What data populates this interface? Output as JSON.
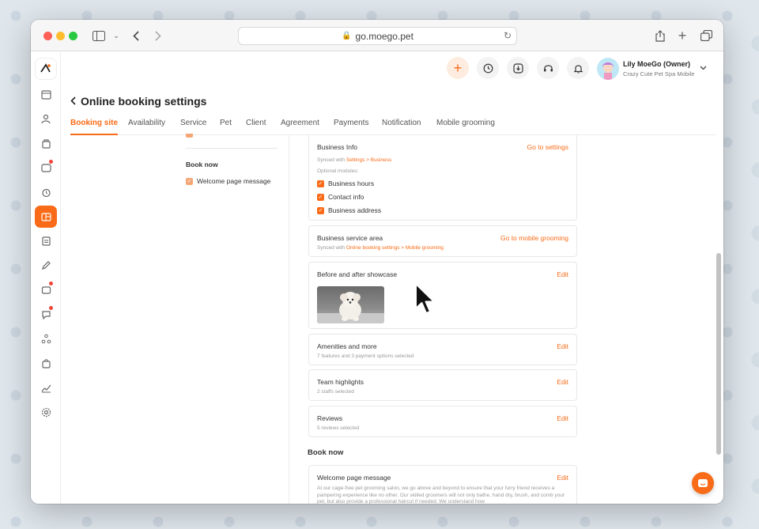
{
  "browser": {
    "url": "go.moego.pet"
  },
  "header": {
    "user_name": "Lily MoeGo (Owner)",
    "business_name": "Crazy Cute Pet Spa Mobile"
  },
  "page": {
    "title": "Online booking settings",
    "tabs": [
      {
        "label": "Booking site",
        "active": true
      },
      {
        "label": "Availability",
        "active": false
      },
      {
        "label": "Service",
        "active": false
      },
      {
        "label": "Pet",
        "active": false
      },
      {
        "label": "Client",
        "active": false
      },
      {
        "label": "Agreement",
        "active": false
      },
      {
        "label": "Payments",
        "active": false
      },
      {
        "label": "Notification",
        "active": false
      },
      {
        "label": "Mobile grooming",
        "active": false
      }
    ]
  },
  "sidebar": {
    "book_now_heading": "Book now",
    "welcome_check_label": "Welcome page message"
  },
  "cards": {
    "business_info": {
      "title": "Business Info",
      "link": "Go to settings",
      "synced_prefix": "Synced with ",
      "synced_path": "Settings > Business",
      "optional_label": "Optional modules:",
      "options": [
        "Business hours",
        "Contact info",
        "Business address"
      ]
    },
    "service_area": {
      "title": "Business service area",
      "link": "Go to mobile grooming",
      "synced_prefix": "Synced with ",
      "synced_path": "Online booking settings > Mobile grooming"
    },
    "showcase": {
      "title": "Before and after showcase",
      "link": "Edit"
    },
    "amenities": {
      "title": "Amenities and more",
      "link": "Edit",
      "summary": "7 features and 3 payment options selected"
    },
    "team": {
      "title": "Team highlights",
      "link": "Edit",
      "summary": "2 staffs selected"
    },
    "reviews": {
      "title": "Reviews",
      "link": "Edit",
      "summary": "5 reviews selected"
    }
  },
  "book_now": {
    "heading": "Book now",
    "welcome": {
      "title": "Welcome page message",
      "link": "Edit",
      "body": "At our cage-free pet grooming salon, we go above and beyond to ensure that your furry friend receives a pampering experience like no other. Our skilled groomers will not only bathe, hand dry, brush, and comb your pet, but also provide a professional haircut if needed. We understand how"
    }
  },
  "colors": {
    "accent": "#f96b18",
    "notification_dot": "#f04438"
  }
}
